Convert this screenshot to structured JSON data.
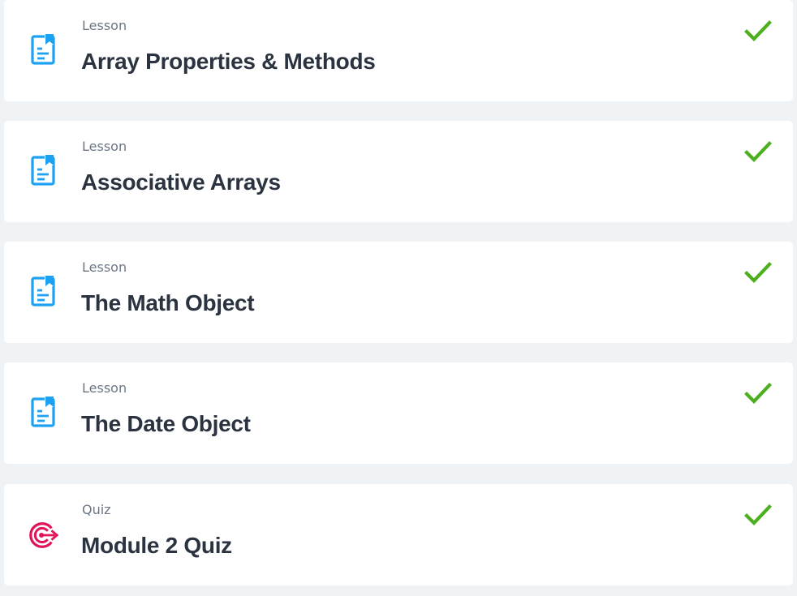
{
  "accent_colors": {
    "lesson_icon": "#1da1f2",
    "quiz_icon": "#e0145a",
    "check": "#4caf1e"
  },
  "items": [
    {
      "kind": "Lesson",
      "title": "Array Properties & Methods",
      "icon": "lesson-document-icon",
      "status": "completed"
    },
    {
      "kind": "Lesson",
      "title": "Associative Arrays",
      "icon": "lesson-document-icon",
      "status": "completed"
    },
    {
      "kind": "Lesson",
      "title": "The Math Object",
      "icon": "lesson-document-icon",
      "status": "completed"
    },
    {
      "kind": "Lesson",
      "title": "The Date Object",
      "icon": "lesson-document-icon",
      "status": "completed"
    },
    {
      "kind": "Quiz",
      "title": "Module 2 Quiz",
      "icon": "quiz-target-icon",
      "status": "completed"
    }
  ]
}
